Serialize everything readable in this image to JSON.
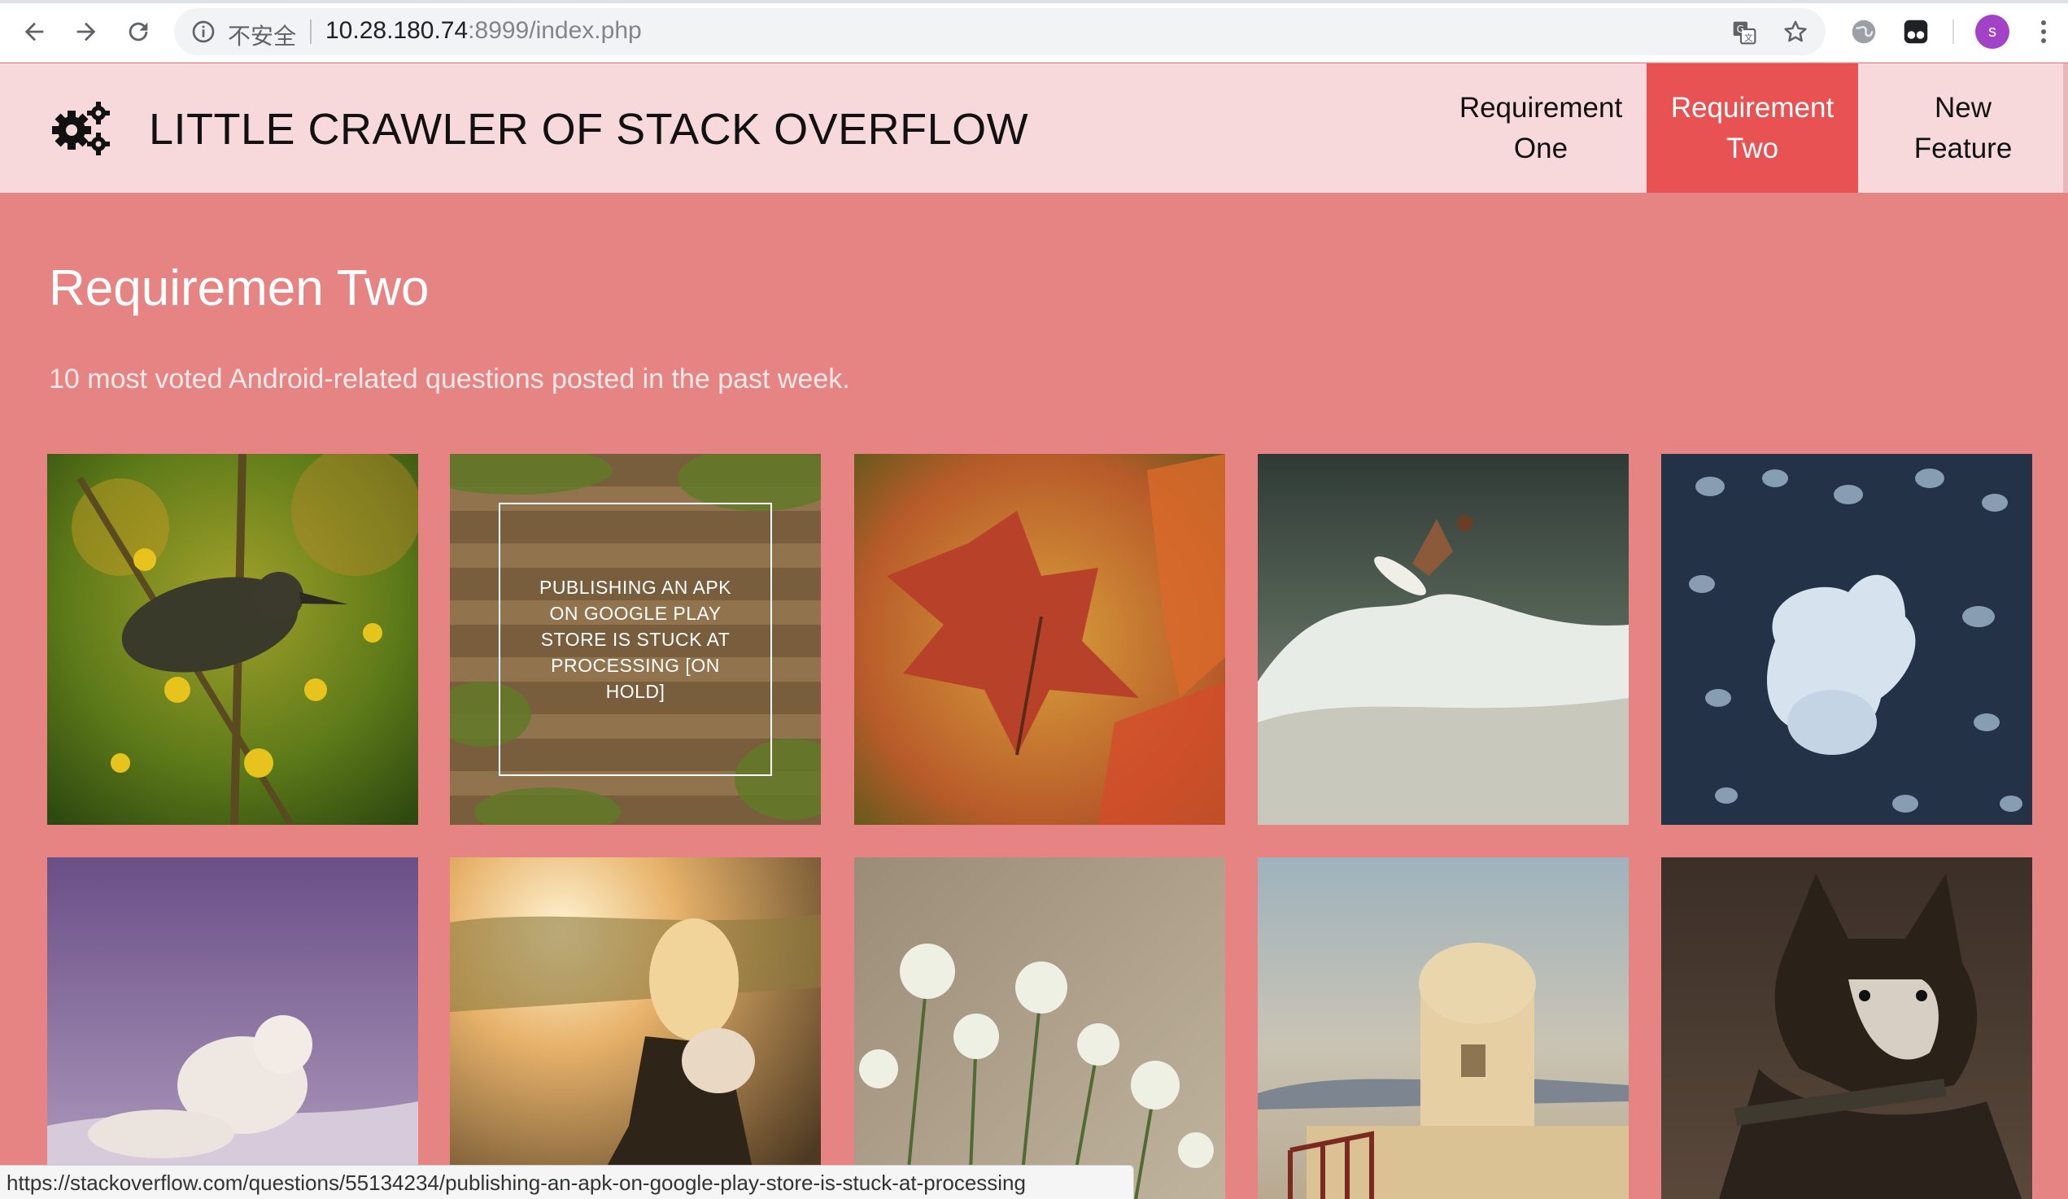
{
  "browser": {
    "security_label": "不安全",
    "url_host": "10.28.180.74",
    "url_rest": ":8999/index.php",
    "profile_initial": "s"
  },
  "site": {
    "title": "LITTLE CRAWLER OF STACK OVERFLOW",
    "logo_icon": "gears-icon",
    "menu": [
      {
        "label": "Requirement One",
        "active": false
      },
      {
        "label": "Requirement Two",
        "active": true
      },
      {
        "label": "New Feature",
        "active": false
      }
    ]
  },
  "page": {
    "heading": "Requiremen Two",
    "subheading": "10 most voted Android-related questions posted in the past week."
  },
  "tiles": [
    {
      "image": "bird on yellow witch-hazel branch",
      "overlay": ""
    },
    {
      "image": "green terraced building",
      "overlay": "PUBLISHING AN APK ON GOOGLE PLAY STORE IS STUCK AT PROCESSING [ON HOLD]"
    },
    {
      "image": "red autumn leaf",
      "overlay": ""
    },
    {
      "image": "surfer on wave",
      "overlay": ""
    },
    {
      "image": "jellyfish",
      "overlay": ""
    },
    {
      "image": "arctic fox on snow",
      "overlay": ""
    },
    {
      "image": "woman sitting at sunset",
      "overlay": ""
    },
    {
      "image": "white flowers",
      "overlay": ""
    },
    {
      "image": "white tower by the sea",
      "overlay": ""
    },
    {
      "image": "husky dog",
      "overlay": ""
    }
  ],
  "status_url": "https://stackoverflow.com/questions/55134234/publishing-an-apk-on-google-play-store-is-stuck-at-processing",
  "colors": {
    "header_bg": "#f7d9db",
    "active_menu": "#e85252",
    "main_bg": "#e58483"
  }
}
